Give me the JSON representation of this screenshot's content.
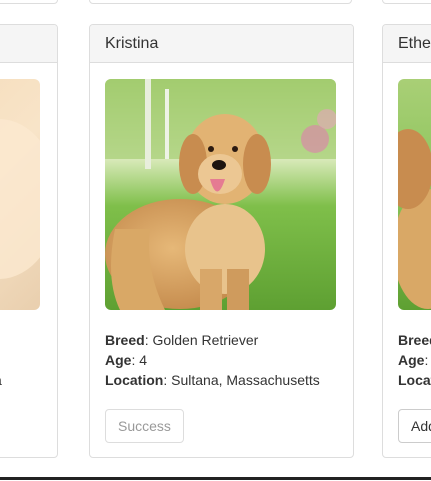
{
  "cards": [
    {
      "name": "",
      "breed_partial": "",
      "age_partial": "",
      "location_partial": "a",
      "button_label": ""
    },
    {
      "name": "Kristina",
      "breed_label": "Breed",
      "breed": ": Golden Retriever",
      "age_label": "Age",
      "age": ": 4",
      "location_label": "Location",
      "location": ": Sultana, Massachusetts",
      "button_label": "Success",
      "button_state": "disabled"
    },
    {
      "name": "Ethe",
      "breed_label": "Breed",
      "breed": ":",
      "age_label": "Age",
      "age": ":",
      "location_label": "Locat",
      "location": "",
      "button_label": "Add"
    }
  ],
  "colors": {
    "header_bg": "#f5f5f5",
    "border": "#dddddd",
    "text": "#333333",
    "disabled_text": "#999999"
  }
}
